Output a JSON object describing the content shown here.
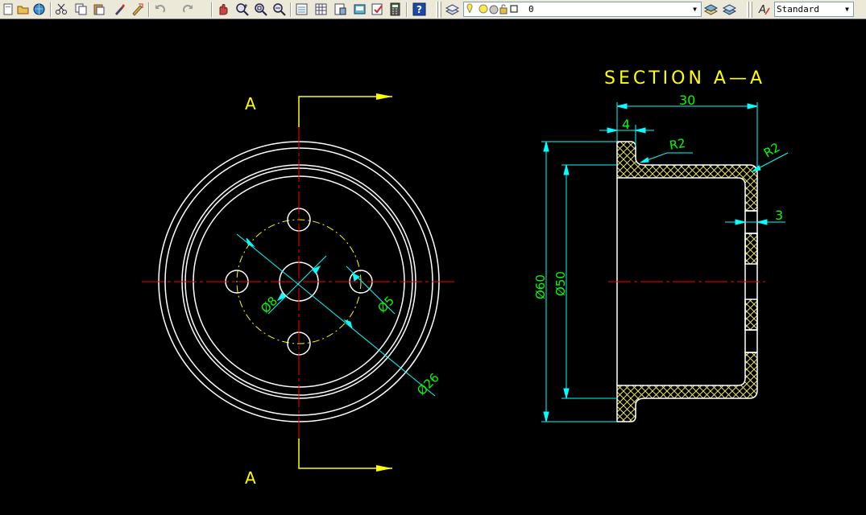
{
  "toolbar": {
    "layer_value": "0",
    "text_style_value": "Standard",
    "icons": [
      "qnew-icon",
      "open-icon",
      "save-icon",
      "plot-icon",
      "cut-icon",
      "copy-icon",
      "paste-icon",
      "match-properties-icon",
      "block-editor-icon",
      "undo-icon",
      "redo-icon",
      "pan-icon",
      "zoom-realtime-icon",
      "zoom-window-icon",
      "zoom-previous-icon",
      "properties-icon",
      "design-center-icon",
      "tool-palettes-icon",
      "sheet-set-icon",
      "markup-icon",
      "quickcalc-icon",
      "help-icon",
      "layer-manager-icon",
      "layer-previous-icon",
      "text-style-icon"
    ],
    "colors": {
      "bg": "#ece9d8",
      "button_face": "#d4d0c8"
    }
  },
  "drawing": {
    "section_title": "SECTION A—A",
    "section_label_top": "A",
    "section_label_bottom": "A",
    "dims": {
      "dia8": "Ø8",
      "dia5": "Ø5",
      "dia26": "Ø26",
      "dia60": "Ø60",
      "dia50": "Ø50",
      "len30": "30",
      "len4": "4",
      "len3": "3",
      "r2_inner": "R2",
      "r2_outer": "R2"
    },
    "colors": {
      "background": "#000000",
      "outline": "#ffffff",
      "centerline": "#ff0000",
      "hidden": "#ffff00",
      "dimension_line": "#00ffff",
      "dimension_text": "#00ff00",
      "annotation": "#ffff00",
      "hatch": "#e6e070"
    }
  }
}
